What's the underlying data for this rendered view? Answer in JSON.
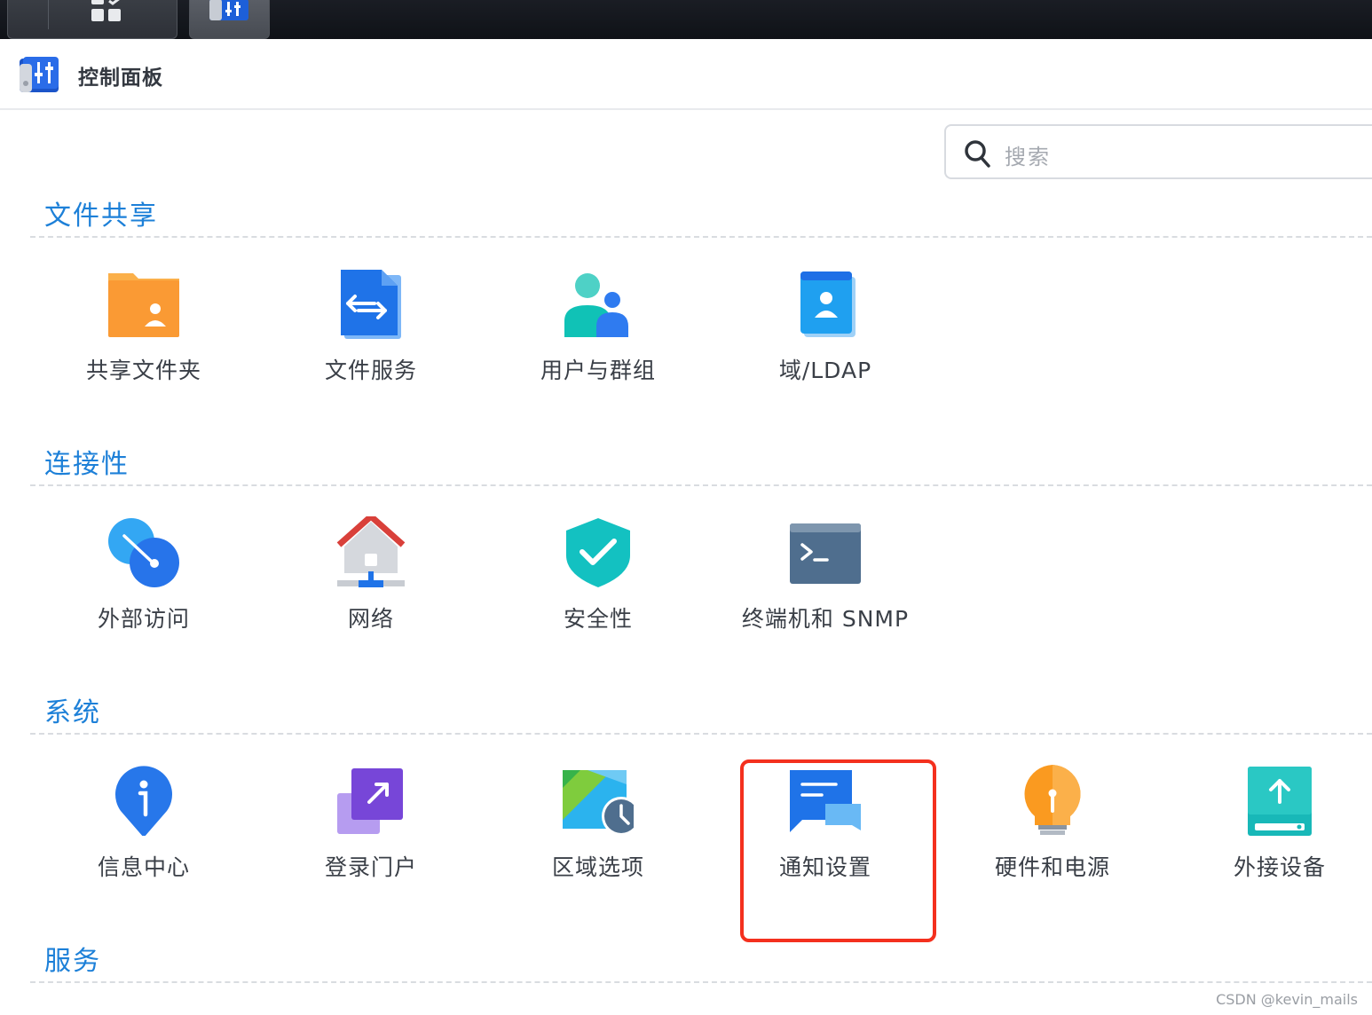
{
  "window": {
    "title": "控制面板"
  },
  "search": {
    "placeholder": "搜索"
  },
  "sections": [
    {
      "title": "文件共享",
      "items": [
        {
          "label": "共享文件夹",
          "icon": "shared-folder-icon"
        },
        {
          "label": "文件服务",
          "icon": "file-services-icon"
        },
        {
          "label": "用户与群组",
          "icon": "users-groups-icon"
        },
        {
          "label": "域/LDAP",
          "icon": "domain-ldap-icon"
        }
      ]
    },
    {
      "title": "连接性",
      "items": [
        {
          "label": "外部访问",
          "icon": "external-access-icon"
        },
        {
          "label": "网络",
          "icon": "network-icon"
        },
        {
          "label": "安全性",
          "icon": "security-shield-icon"
        },
        {
          "label": "终端机和 SNMP",
          "icon": "terminal-snmp-icon"
        }
      ]
    },
    {
      "title": "系统",
      "items": [
        {
          "label": "信息中心",
          "icon": "info-center-icon"
        },
        {
          "label": "登录门户",
          "icon": "login-portal-icon"
        },
        {
          "label": "区域选项",
          "icon": "regional-options-icon"
        },
        {
          "label": "通知设置",
          "icon": "notification-icon"
        },
        {
          "label": "硬件和电源",
          "icon": "hardware-power-icon"
        },
        {
          "label": "外接设备",
          "icon": "external-devices-icon"
        }
      ]
    },
    {
      "title": "服务"
    }
  ],
  "highlight": {
    "color": "#f4301e",
    "item": "通知设置"
  },
  "watermark": "CSDN @kevin_mails",
  "colors": {
    "section_title": "#1d80d8",
    "label": "#3a3f47"
  }
}
